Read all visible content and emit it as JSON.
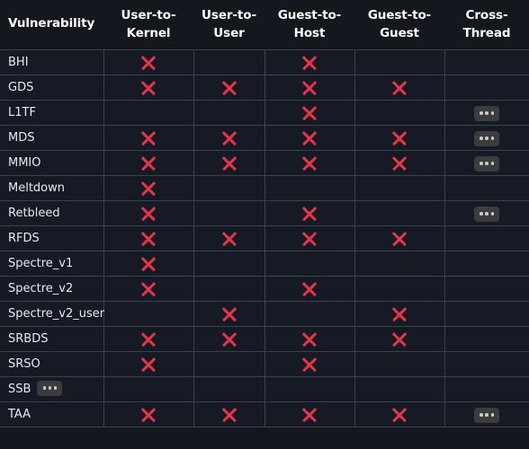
{
  "table": {
    "columns": [
      {
        "id": "vulnerability",
        "lines": [
          "Vulnerability"
        ]
      },
      {
        "id": "user-to-kernel",
        "lines": [
          "User-to-",
          "Kernel"
        ]
      },
      {
        "id": "user-to-user",
        "lines": [
          "User-to-",
          "User"
        ]
      },
      {
        "id": "guest-to-host",
        "lines": [
          "Guest-to-",
          "Host"
        ]
      },
      {
        "id": "guest-to-guest",
        "lines": [
          "Guest-to-",
          "Guest"
        ]
      },
      {
        "id": "cross-thread",
        "lines": [
          "Cross-",
          "Thread"
        ]
      }
    ],
    "rows": [
      {
        "name": "BHI",
        "name_badge": false,
        "cells": [
          "x",
          "",
          "x",
          "",
          ""
        ]
      },
      {
        "name": "GDS",
        "name_badge": false,
        "cells": [
          "x",
          "x",
          "x",
          "x",
          ""
        ]
      },
      {
        "name": "L1TF",
        "name_badge": false,
        "cells": [
          "",
          "",
          "x",
          "",
          "dots"
        ]
      },
      {
        "name": "MDS",
        "name_badge": false,
        "cells": [
          "x",
          "x",
          "x",
          "x",
          "dots"
        ]
      },
      {
        "name": "MMIO",
        "name_badge": false,
        "cells": [
          "x",
          "x",
          "x",
          "x",
          "dots"
        ]
      },
      {
        "name": "Meltdown",
        "name_badge": false,
        "cells": [
          "x",
          "",
          "",
          "",
          ""
        ]
      },
      {
        "name": "Retbleed",
        "name_badge": false,
        "cells": [
          "x",
          "",
          "x",
          "",
          "dots"
        ]
      },
      {
        "name": "RFDS",
        "name_badge": false,
        "cells": [
          "x",
          "x",
          "x",
          "x",
          ""
        ]
      },
      {
        "name": "Spectre_v1",
        "name_badge": false,
        "cells": [
          "x",
          "",
          "",
          "",
          ""
        ]
      },
      {
        "name": "Spectre_v2",
        "name_badge": false,
        "cells": [
          "x",
          "",
          "x",
          "",
          ""
        ]
      },
      {
        "name": "Spectre_v2_user",
        "name_badge": false,
        "cells": [
          "",
          "x",
          "",
          "x",
          ""
        ]
      },
      {
        "name": "SRBDS",
        "name_badge": false,
        "cells": [
          "x",
          "x",
          "x",
          "x",
          ""
        ]
      },
      {
        "name": "SRSO",
        "name_badge": false,
        "cells": [
          "x",
          "",
          "x",
          "",
          ""
        ]
      },
      {
        "name": "SSB",
        "name_badge": true,
        "cells": [
          "",
          "",
          "",
          "",
          ""
        ]
      },
      {
        "name": "TAA",
        "name_badge": false,
        "cells": [
          "x",
          "x",
          "x",
          "x",
          "dots"
        ]
      }
    ],
    "legend": {
      "x_symbol": "✕",
      "dots_symbol": "•••"
    }
  },
  "colors": {
    "page_background": "#14171e",
    "cell_background": "#151a24",
    "grid_line": "#3c4049",
    "x_mark": "#e8344b",
    "badge_background": "#3c3c3c",
    "badge_dot": "#c9cbce",
    "header_text": "#ffffff",
    "body_text": "#e6e9ee"
  }
}
